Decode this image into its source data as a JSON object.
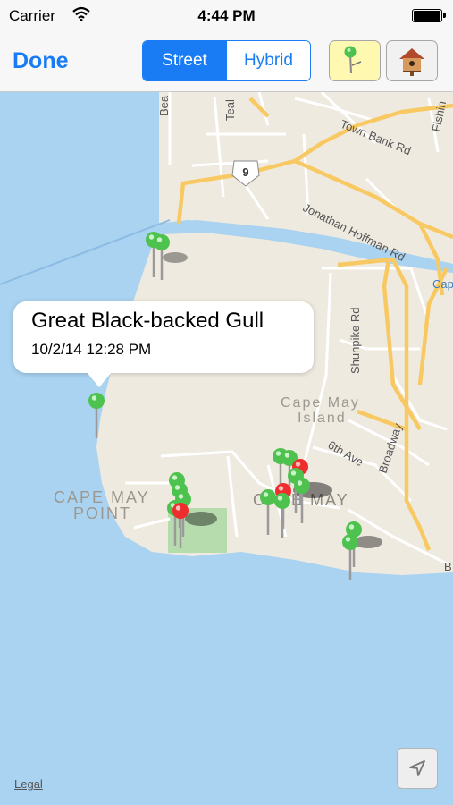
{
  "status_bar": {
    "carrier": "Carrier",
    "time": "4:44 PM"
  },
  "toolbar": {
    "done_label": "Done",
    "segments": [
      {
        "label": "Street",
        "selected": true
      },
      {
        "label": "Hybrid",
        "selected": false
      }
    ],
    "pin_button_icon": "green-pin-icon",
    "house_button_icon": "birdhouse-icon"
  },
  "map": {
    "labels": {
      "road_9": "9",
      "town_bank_rd": "Town Bank Rd",
      "jonathan_hoffman_rd": "Jonathan Hoffman Rd",
      "shunpike_rd": "Shunpike Rd",
      "broadway": "Broadway",
      "sixth_ave": "6th Ave",
      "island_line1": "Cape May",
      "island_line2": "Island",
      "point_line1": "CAPE MAY",
      "point_line2": "POINT",
      "cape_may": "CAPE MAY",
      "beach": "Bea",
      "teal": "Teal",
      "fishing": "Fishin",
      "cap": "Cap",
      "b_edge": "B"
    },
    "callout": {
      "title": "Great Black-backed Gull",
      "date": "10/2/14 12:28 PM"
    },
    "legal_label": "Legal",
    "colors": {
      "water": "#a9d3f0",
      "land": "#efeae0",
      "major_road": "#f8c963",
      "park": "#b6dcae",
      "pin_green": "#4ec24e",
      "pin_red": "#ee2d2d"
    }
  }
}
